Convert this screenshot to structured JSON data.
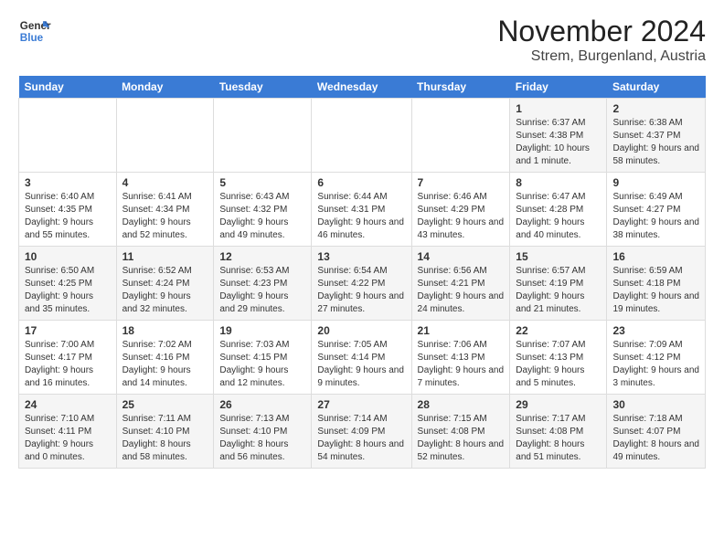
{
  "header": {
    "logo_line1": "General",
    "logo_line2": "Blue",
    "title": "November 2024",
    "subtitle": "Strem, Burgenland, Austria"
  },
  "columns": [
    "Sunday",
    "Monday",
    "Tuesday",
    "Wednesday",
    "Thursday",
    "Friday",
    "Saturday"
  ],
  "weeks": [
    {
      "days": [
        {
          "num": "",
          "info": ""
        },
        {
          "num": "",
          "info": ""
        },
        {
          "num": "",
          "info": ""
        },
        {
          "num": "",
          "info": ""
        },
        {
          "num": "",
          "info": ""
        },
        {
          "num": "1",
          "info": "Sunrise: 6:37 AM\nSunset: 4:38 PM\nDaylight: 10 hours and 1 minute."
        },
        {
          "num": "2",
          "info": "Sunrise: 6:38 AM\nSunset: 4:37 PM\nDaylight: 9 hours and 58 minutes."
        }
      ]
    },
    {
      "days": [
        {
          "num": "3",
          "info": "Sunrise: 6:40 AM\nSunset: 4:35 PM\nDaylight: 9 hours and 55 minutes."
        },
        {
          "num": "4",
          "info": "Sunrise: 6:41 AM\nSunset: 4:34 PM\nDaylight: 9 hours and 52 minutes."
        },
        {
          "num": "5",
          "info": "Sunrise: 6:43 AM\nSunset: 4:32 PM\nDaylight: 9 hours and 49 minutes."
        },
        {
          "num": "6",
          "info": "Sunrise: 6:44 AM\nSunset: 4:31 PM\nDaylight: 9 hours and 46 minutes."
        },
        {
          "num": "7",
          "info": "Sunrise: 6:46 AM\nSunset: 4:29 PM\nDaylight: 9 hours and 43 minutes."
        },
        {
          "num": "8",
          "info": "Sunrise: 6:47 AM\nSunset: 4:28 PM\nDaylight: 9 hours and 40 minutes."
        },
        {
          "num": "9",
          "info": "Sunrise: 6:49 AM\nSunset: 4:27 PM\nDaylight: 9 hours and 38 minutes."
        }
      ]
    },
    {
      "days": [
        {
          "num": "10",
          "info": "Sunrise: 6:50 AM\nSunset: 4:25 PM\nDaylight: 9 hours and 35 minutes."
        },
        {
          "num": "11",
          "info": "Sunrise: 6:52 AM\nSunset: 4:24 PM\nDaylight: 9 hours and 32 minutes."
        },
        {
          "num": "12",
          "info": "Sunrise: 6:53 AM\nSunset: 4:23 PM\nDaylight: 9 hours and 29 minutes."
        },
        {
          "num": "13",
          "info": "Sunrise: 6:54 AM\nSunset: 4:22 PM\nDaylight: 9 hours and 27 minutes."
        },
        {
          "num": "14",
          "info": "Sunrise: 6:56 AM\nSunset: 4:21 PM\nDaylight: 9 hours and 24 minutes."
        },
        {
          "num": "15",
          "info": "Sunrise: 6:57 AM\nSunset: 4:19 PM\nDaylight: 9 hours and 21 minutes."
        },
        {
          "num": "16",
          "info": "Sunrise: 6:59 AM\nSunset: 4:18 PM\nDaylight: 9 hours and 19 minutes."
        }
      ]
    },
    {
      "days": [
        {
          "num": "17",
          "info": "Sunrise: 7:00 AM\nSunset: 4:17 PM\nDaylight: 9 hours and 16 minutes."
        },
        {
          "num": "18",
          "info": "Sunrise: 7:02 AM\nSunset: 4:16 PM\nDaylight: 9 hours and 14 minutes."
        },
        {
          "num": "19",
          "info": "Sunrise: 7:03 AM\nSunset: 4:15 PM\nDaylight: 9 hours and 12 minutes."
        },
        {
          "num": "20",
          "info": "Sunrise: 7:05 AM\nSunset: 4:14 PM\nDaylight: 9 hours and 9 minutes."
        },
        {
          "num": "21",
          "info": "Sunrise: 7:06 AM\nSunset: 4:13 PM\nDaylight: 9 hours and 7 minutes."
        },
        {
          "num": "22",
          "info": "Sunrise: 7:07 AM\nSunset: 4:13 PM\nDaylight: 9 hours and 5 minutes."
        },
        {
          "num": "23",
          "info": "Sunrise: 7:09 AM\nSunset: 4:12 PM\nDaylight: 9 hours and 3 minutes."
        }
      ]
    },
    {
      "days": [
        {
          "num": "24",
          "info": "Sunrise: 7:10 AM\nSunset: 4:11 PM\nDaylight: 9 hours and 0 minutes."
        },
        {
          "num": "25",
          "info": "Sunrise: 7:11 AM\nSunset: 4:10 PM\nDaylight: 8 hours and 58 minutes."
        },
        {
          "num": "26",
          "info": "Sunrise: 7:13 AM\nSunset: 4:10 PM\nDaylight: 8 hours and 56 minutes."
        },
        {
          "num": "27",
          "info": "Sunrise: 7:14 AM\nSunset: 4:09 PM\nDaylight: 8 hours and 54 minutes."
        },
        {
          "num": "28",
          "info": "Sunrise: 7:15 AM\nSunset: 4:08 PM\nDaylight: 8 hours and 52 minutes."
        },
        {
          "num": "29",
          "info": "Sunrise: 7:17 AM\nSunset: 4:08 PM\nDaylight: 8 hours and 51 minutes."
        },
        {
          "num": "30",
          "info": "Sunrise: 7:18 AM\nSunset: 4:07 PM\nDaylight: 8 hours and 49 minutes."
        }
      ]
    }
  ]
}
